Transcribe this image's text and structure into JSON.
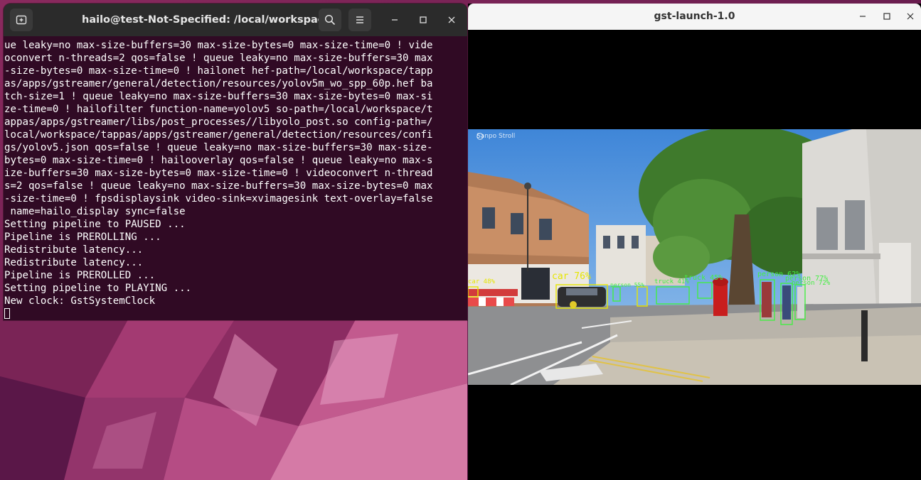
{
  "terminal": {
    "title": "hailo@test-Not-Specified: /local/workspace",
    "lines": [
      "ue leaky=no max-size-buffers=30 max-size-bytes=0 max-size-time=0 ! vide",
      "oconvert n-threads=2 qos=false ! queue leaky=no max-size-buffers=30 max",
      "-size-bytes=0 max-size-time=0 ! hailonet hef-path=/local/workspace/tapp",
      "as/apps/gstreamer/general/detection/resources/yolov5m_wo_spp_60p.hef ba",
      "tch-size=1 ! queue leaky=no max-size-buffers=30 max-size-bytes=0 max-si",
      "ze-time=0 ! hailofilter function-name=yolov5 so-path=/local/workspace/t",
      "appas/apps/gstreamer/libs/post_processes//libyolo_post.so config-path=/",
      "local/workspace/tappas/apps/gstreamer/general/detection/resources/confi",
      "gs/yolov5.json qos=false ! queue leaky=no max-size-buffers=30 max-size-",
      "bytes=0 max-size-time=0 ! hailooverlay qos=false ! queue leaky=no max-s",
      "ize-buffers=30 max-size-bytes=0 max-size-time=0 ! videoconvert n-thread",
      "s=2 qos=false ! queue leaky=no max-size-buffers=30 max-size-bytes=0 max",
      "-size-time=0 ! fpsdisplaysink video-sink=xvimagesink text-overlay=false",
      " name=hailo_display sync=false",
      "Setting pipeline to PAUSED ...",
      "Pipeline is PREROLLING ...",
      "Redistribute latency...",
      "Redistribute latency...",
      "Pipeline is PREROLLED ...",
      "Setting pipeline to PLAYING ...",
      "New clock: GstSystemClock"
    ]
  },
  "video_window": {
    "title": "gst-launch-1.0",
    "watermark": "Sanpo Stroll",
    "detections": [
      {
        "label": "car 76%",
        "color": "#e6e600"
      },
      {
        "label": "car 48%",
        "color": "#e6e600"
      },
      {
        "label": "truck 45%",
        "color": "#44ee44"
      },
      {
        "label": "person 62%",
        "color": "#44ee44"
      },
      {
        "label": "person 77%",
        "color": "#44ee44"
      },
      {
        "label": "person 72%",
        "color": "#44ee44"
      },
      {
        "label": "person 55%",
        "color": "#44ee44"
      },
      {
        "label": "truck 41%",
        "color": "#44ee44"
      }
    ]
  },
  "colors": {
    "terminal_bg": "#300a24",
    "titlebar_dark": "#2b2b2b",
    "titlebar_light": "#f5f5f5",
    "wallpaper": "#6b1f4e"
  }
}
